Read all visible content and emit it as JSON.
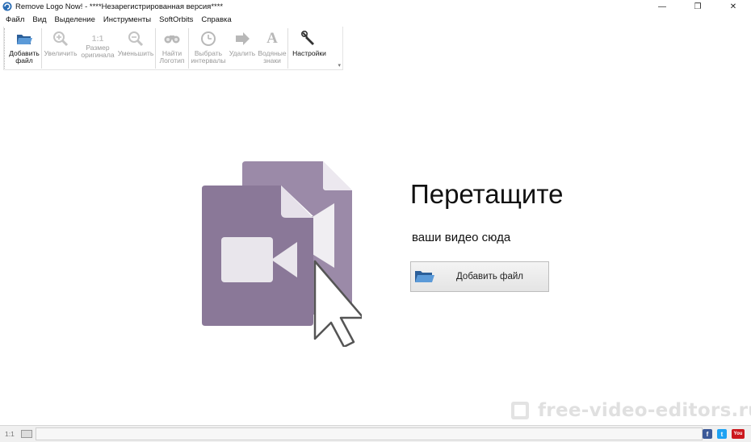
{
  "window": {
    "title": "Remove Logo Now! - ****Незарегистрированная версия****",
    "minimize_glyph": "—",
    "restore_glyph": "❐",
    "close_glyph": "✕"
  },
  "menu": [
    {
      "label": "Файл"
    },
    {
      "label": "Вид"
    },
    {
      "label": "Выделение"
    },
    {
      "label": "Инструменты"
    },
    {
      "label": "SoftOrbits"
    },
    {
      "label": "Справка"
    }
  ],
  "toolbar": {
    "add_file": {
      "line1": "Добавить",
      "line2": "файл"
    },
    "zoom_in": {
      "line1": "Увеличить",
      "line2": ""
    },
    "original_size": {
      "glyph": "1:1",
      "line1": "Размер",
      "line2": "оригинала"
    },
    "zoom_out": {
      "line1": "Уменьшить",
      "line2": ""
    },
    "find_logo": {
      "line1": "Найти",
      "line2": "Логотип"
    },
    "select_intervals": {
      "line1": "Выбрать",
      "line2": "интервалы"
    },
    "remove": {
      "line1": "Удалить",
      "line2": ""
    },
    "watermarks": {
      "glyph": "A",
      "line1": "Водяные",
      "line2": "знаки"
    },
    "settings": {
      "line1": "Настройки",
      "line2": ""
    }
  },
  "drop_zone": {
    "title": "Перетащите",
    "subtitle": "ваши видео сюда",
    "button_label": "Добавить файл"
  },
  "watermark_text": "free-video-editors.ru",
  "status": {
    "zoom_label": "1:1",
    "social": [
      {
        "name": "facebook-icon",
        "glyph": "f",
        "color": "#3b5998"
      },
      {
        "name": "twitter-icon",
        "glyph": "t",
        "color": "#1da1f2"
      },
      {
        "name": "youtube-icon",
        "glyph": "You",
        "color": "#cc181e"
      }
    ]
  },
  "colors": {
    "illustration_purple": "#8a7898",
    "illustration_purple_back": "#9b8aa8",
    "accent_blue": "#2a6db5"
  }
}
